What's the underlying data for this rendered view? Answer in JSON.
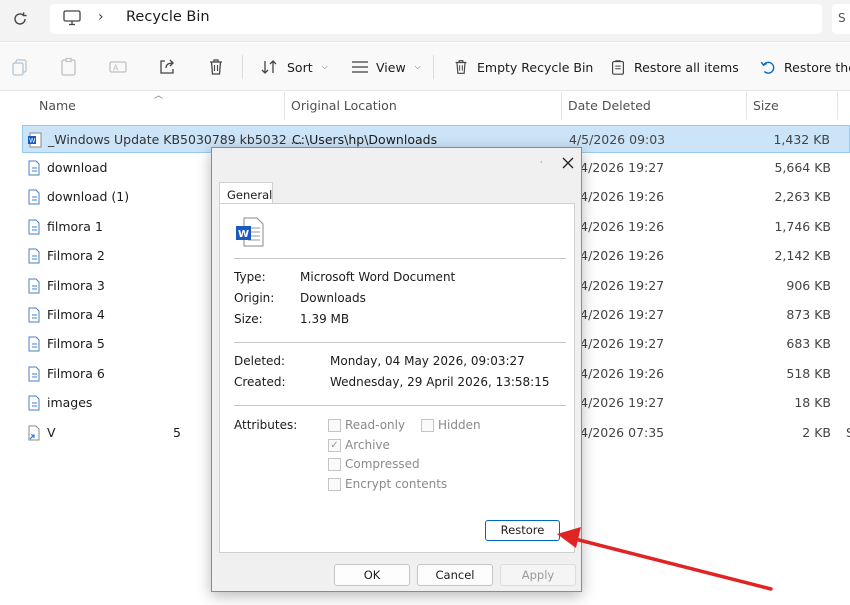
{
  "address": {
    "crumb": "Recycle Bin",
    "search_stub": "S"
  },
  "toolbar": {
    "sort_label": "Sort",
    "view_label": "View",
    "empty_label": "Empty Recycle Bin",
    "restore_all_label": "Restore all items",
    "restore_sel_label": "Restore the"
  },
  "columns": {
    "name": "Name",
    "location": "Original Location",
    "date": "Date Deleted",
    "size": "Size"
  },
  "rows": [
    {
      "name": "_Windows Update KB5030789 kb5032 ...",
      "location": "C:\\Users\\hp\\Downloads",
      "date": "4/5/2026 09:03",
      "size": "1,432 KB",
      "icon": "word-doc-icon"
    },
    {
      "name": "download",
      "date": "4/4/2026 19:27",
      "size": "5,664 KB",
      "icon": "document-icon"
    },
    {
      "name": "download (1)",
      "date": "4/4/2026 19:26",
      "size": "2,263 KB",
      "icon": "document-icon"
    },
    {
      "name": "filmora 1",
      "date": "4/4/2026 19:26",
      "size": "1,746 KB",
      "icon": "document-icon"
    },
    {
      "name": "Filmora 2",
      "date": "4/4/2026 19:26",
      "size": "2,142 KB",
      "icon": "document-icon"
    },
    {
      "name": "Filmora 3",
      "date": "4/4/2026 19:27",
      "size": "906 KB",
      "icon": "document-icon"
    },
    {
      "name": "Filmora 4",
      "date": "4/4/2026 19:27",
      "size": "873 KB",
      "icon": "document-icon"
    },
    {
      "name": "Filmora 5",
      "date": "4/4/2026 19:27",
      "size": "683 KB",
      "icon": "document-icon"
    },
    {
      "name": "Filmora 6",
      "date": "4/4/2026 19:26",
      "size": "518 KB",
      "icon": "document-icon"
    },
    {
      "name": "images",
      "date": "4/4/2026 19:27",
      "size": "18 KB",
      "icon": "document-icon"
    },
    {
      "name": "V",
      "extra": "5",
      "date": "4/4/2026 07:35",
      "size": "2 KB",
      "tail": "S",
      "icon": "shortcut-icon"
    }
  ],
  "dialog": {
    "tab": "General",
    "type_label": "Type:",
    "type_value": "Microsoft Word Document",
    "origin_label": "Origin:",
    "origin_value": "Downloads",
    "size_label": "Size:",
    "size_value": "1.39 MB",
    "deleted_label": "Deleted:",
    "deleted_value": "Monday, 04 May 2026, 09:03:27",
    "created_label": "Created:",
    "created_value": "Wednesday, 29 April 2026, 13:58:15",
    "attributes_label": "Attributes:",
    "attr_readonly": "Read-only",
    "attr_hidden": "Hidden",
    "attr_archive": "Archive",
    "attr_compressed": "Compressed",
    "attr_encrypt": "Encrypt contents",
    "restore": "Restore",
    "ok": "OK",
    "cancel": "Cancel",
    "apply": "Apply"
  },
  "colors": {
    "selection": "#cce4f7",
    "accent": "#0067c0",
    "annotation_arrow": "#e02424",
    "word_blue": "#185abd"
  }
}
